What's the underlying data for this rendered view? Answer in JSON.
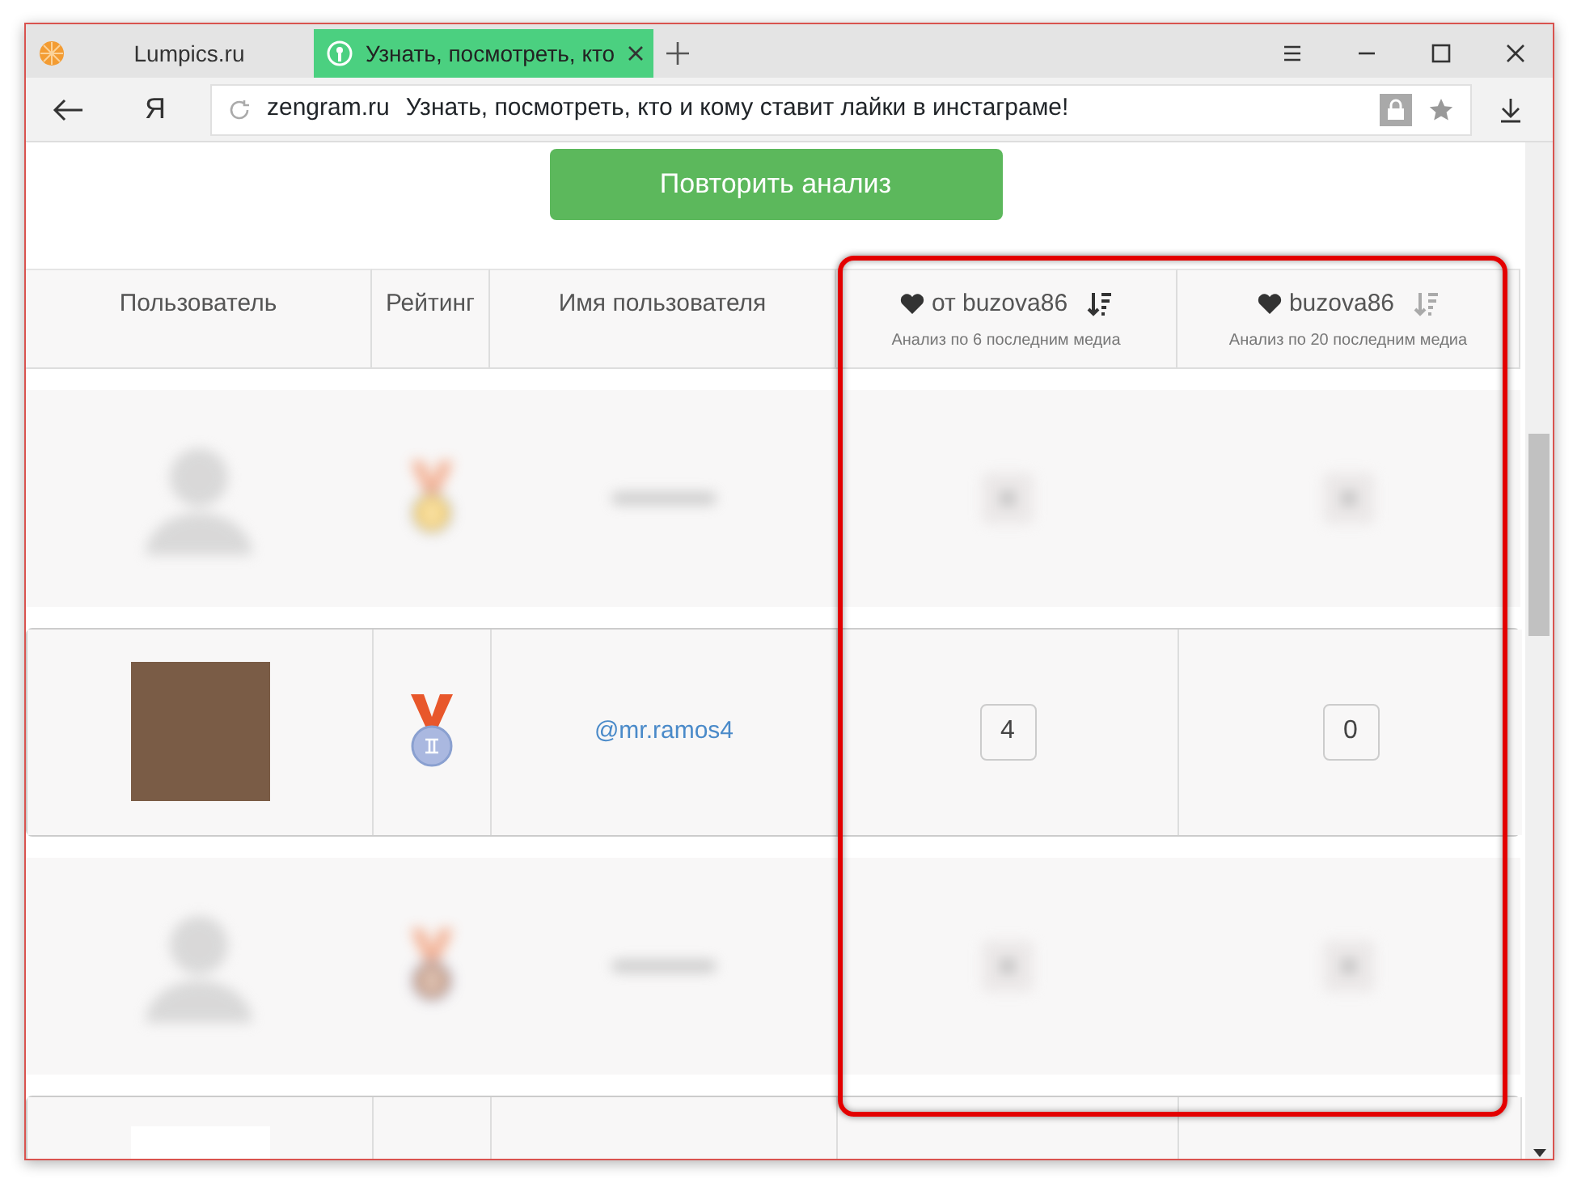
{
  "browser": {
    "tabs": [
      {
        "title": "Lumpics.ru",
        "selected": false,
        "kind": "orange"
      },
      {
        "title": "Узнать, посмотреть, кто",
        "selected": true,
        "kind": "site"
      }
    ],
    "url_domain": "zengram.ru",
    "url_title": "Узнать, посмотреть, кто и кому ставит лайки в инстаграме!",
    "logo": "Я"
  },
  "page": {
    "button": "Повторить анализ",
    "table": {
      "columns": [
        {
          "label": "Пользователь"
        },
        {
          "label": "Рейтинг"
        },
        {
          "label": "Имя пользователя"
        },
        {
          "label": "от buzova86",
          "subtitle": "Анализ по 6 последним медиа",
          "sort_active": true
        },
        {
          "label": "buzova86",
          "subtitle": "Анализ по 20 последним медиа",
          "sort_active": false
        }
      ],
      "rows": [
        {
          "kind": "blurred",
          "medal": {
            "kind": "gold"
          }
        },
        {
          "kind": "clear",
          "medal": {
            "kind": "silver"
          },
          "username": "@mr.ramos4",
          "count_1": "4",
          "count_2": "0"
        },
        {
          "kind": "blurred",
          "medal": {
            "kind": "bronze"
          }
        },
        {
          "kind": "partial"
        }
      ]
    },
    "highlight": true
  }
}
